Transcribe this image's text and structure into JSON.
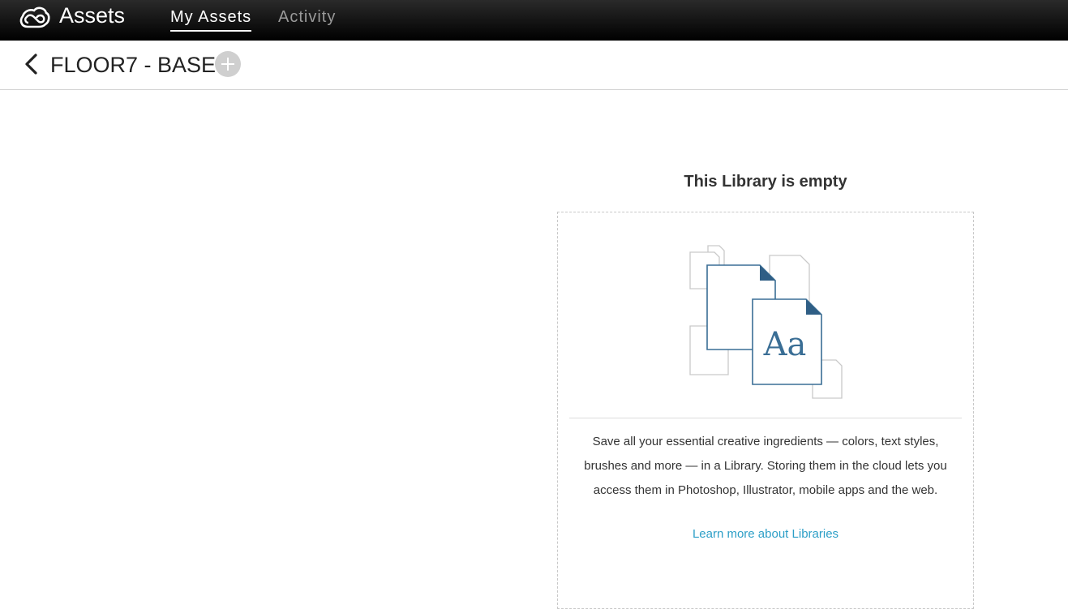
{
  "topbar": {
    "app_title": "Assets",
    "logo_icon": "creative-cloud-icon",
    "tabs": [
      {
        "label": "My Assets",
        "active": true
      },
      {
        "label": "Activity",
        "active": false
      }
    ]
  },
  "header": {
    "back_icon": "chevron-left-icon",
    "library_title": "FLOOR7 - BASE",
    "add_icon": "plus-icon"
  },
  "empty_state": {
    "heading": "This Library is empty",
    "illustration_label": "Aa",
    "description": "Save all your essential creative ingredients — colors, text styles, brushes and more — in a Library. Storing them in the cloud lets you access them in Photoshop, Illustrator, mobile apps and the web.",
    "link_label": "Learn more about Libraries"
  },
  "colors": {
    "topbar": "#000000",
    "accent_blue": "#3a6e95",
    "link": "#2d9fc7",
    "add_button": "#cfcfcf"
  }
}
